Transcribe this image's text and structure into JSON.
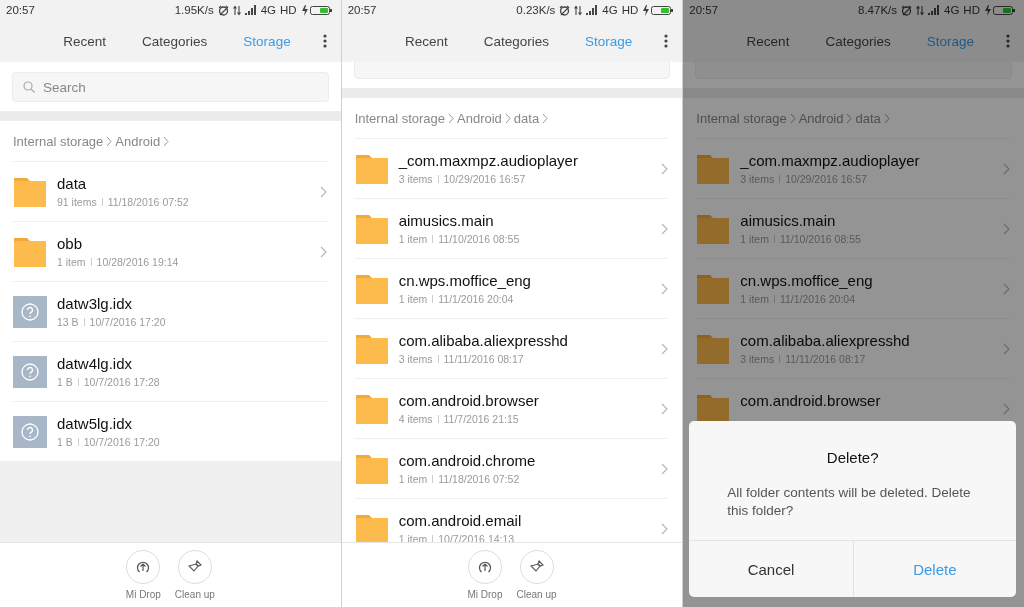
{
  "panels": [
    {
      "status": {
        "time": "20:57",
        "speed": "1.95K/s",
        "network": "4G",
        "hd": "HD"
      },
      "tabs": [
        {
          "label": "Recent",
          "selected": false
        },
        {
          "label": "Categories",
          "selected": false
        },
        {
          "label": "Storage",
          "selected": true
        }
      ],
      "search": {
        "placeholder": "Search"
      },
      "breadcrumb": [
        "Internal storage",
        "Android"
      ],
      "rows": [
        {
          "kind": "folder",
          "name": "data",
          "size": "91 items",
          "date": "11/18/2016 07:52"
        },
        {
          "kind": "folder",
          "name": "obb",
          "size": "1 item",
          "date": "10/28/2016 19:14"
        },
        {
          "kind": "file",
          "name": "datw3lg.idx",
          "size": "13 B",
          "date": "10/7/2016 17:20"
        },
        {
          "kind": "file",
          "name": "datw4lg.idx",
          "size": "1 B",
          "date": "10/7/2016 17:28"
        },
        {
          "kind": "file",
          "name": "datw5lg.idx",
          "size": "1 B",
          "date": "10/7/2016 17:20"
        }
      ],
      "bottom_bar": [
        {
          "kind": "drop",
          "label": "Mi Drop"
        },
        {
          "kind": "clean",
          "label": "Clean up"
        }
      ]
    },
    {
      "status": {
        "time": "20:57",
        "speed": "0.23K/s",
        "network": "4G",
        "hd": "HD"
      },
      "tabs": [
        {
          "label": "Recent",
          "selected": false
        },
        {
          "label": "Categories",
          "selected": false
        },
        {
          "label": "Storage",
          "selected": true
        }
      ],
      "breadcrumb": [
        "Internal storage",
        "Android",
        "data"
      ],
      "rows": [
        {
          "kind": "folder",
          "name": "_com.maxmpz.audioplayer",
          "size": "3 items",
          "date": "10/29/2016 16:57"
        },
        {
          "kind": "folder",
          "name": "aimusics.main",
          "size": "1 item",
          "date": "11/10/2016 08:55"
        },
        {
          "kind": "folder",
          "name": "cn.wps.moffice_eng",
          "size": "1 item",
          "date": "11/1/2016 20:04"
        },
        {
          "kind": "folder",
          "name": "com.alibaba.aliexpresshd",
          "size": "3 items",
          "date": "11/11/2016 08:17"
        },
        {
          "kind": "folder",
          "name": "com.android.browser",
          "size": "4 items",
          "date": "11/7/2016 21:15"
        },
        {
          "kind": "folder",
          "name": "com.android.chrome",
          "size": "1 item",
          "date": "11/18/2016 07:52"
        },
        {
          "kind": "folder",
          "name": "com.android.email",
          "size": "1 item",
          "date": "10/7/2016 14:13"
        }
      ],
      "bottom_bar": [
        {
          "kind": "drop",
          "label": "Mi Drop"
        },
        {
          "kind": "clean",
          "label": "Clean up"
        }
      ]
    },
    {
      "status": {
        "time": "20:57",
        "speed": "8.47K/s",
        "network": "4G",
        "hd": "HD"
      },
      "tabs": [
        {
          "label": "Recent",
          "selected": false
        },
        {
          "label": "Categories",
          "selected": false
        },
        {
          "label": "Storage",
          "selected": true
        }
      ],
      "breadcrumb": [
        "Internal storage",
        "Android",
        "data"
      ],
      "rows": [
        {
          "kind": "folder",
          "name": "_com.maxmpz.audioplayer",
          "size": "3 items",
          "date": "10/29/2016 16:57"
        },
        {
          "kind": "folder",
          "name": "aimusics.main",
          "size": "1 item",
          "date": "11/10/2016 08:55"
        },
        {
          "kind": "folder",
          "name": "cn.wps.moffice_eng",
          "size": "1 item",
          "date": "11/1/2016 20:04"
        },
        {
          "kind": "folder",
          "name": "com.alibaba.aliexpresshd",
          "size": "3 items",
          "date": "11/11/2016 08:17"
        },
        {
          "kind": "folder",
          "name": "com.android.browser"
        }
      ],
      "dialog": {
        "title": "Delete?",
        "message": "All folder contents will be deleted. Delete this folder?",
        "buttons": [
          "Cancel",
          "Delete"
        ]
      }
    }
  ]
}
